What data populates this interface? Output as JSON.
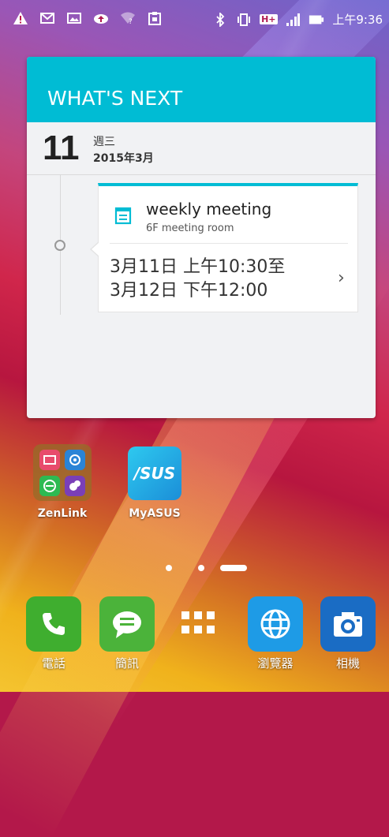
{
  "status_bar": {
    "time": "上午9:36",
    "network_label": "H+",
    "icons_left": [
      "warning-icon",
      "mail-icon",
      "image-icon",
      "cloud-upload-icon",
      "wifi-unknown-icon",
      "clipboard-icon"
    ],
    "icons_right": [
      "bluetooth-icon",
      "vibrate-icon",
      "hplus-icon",
      "signal-icon",
      "battery-icon"
    ]
  },
  "widget": {
    "header": "WHAT'S NEXT",
    "day_number": "11",
    "weekday": "週三",
    "year_month": "2015年3月",
    "event": {
      "title": "weekly meeting",
      "location": "6F meeting room",
      "time_line1": "3月11日 上午10:30至",
      "time_line2": "3月12日 下午12:00",
      "chevron": "›"
    },
    "accent_color": "#00bcd4"
  },
  "home": {
    "folder_label": "ZenLink",
    "asus_label": "MyASUS",
    "asus_logo_text": "/SUS"
  },
  "dock": {
    "phone": "電話",
    "messages": "簡訊",
    "browser": "瀏覽器",
    "camera": "相機"
  }
}
